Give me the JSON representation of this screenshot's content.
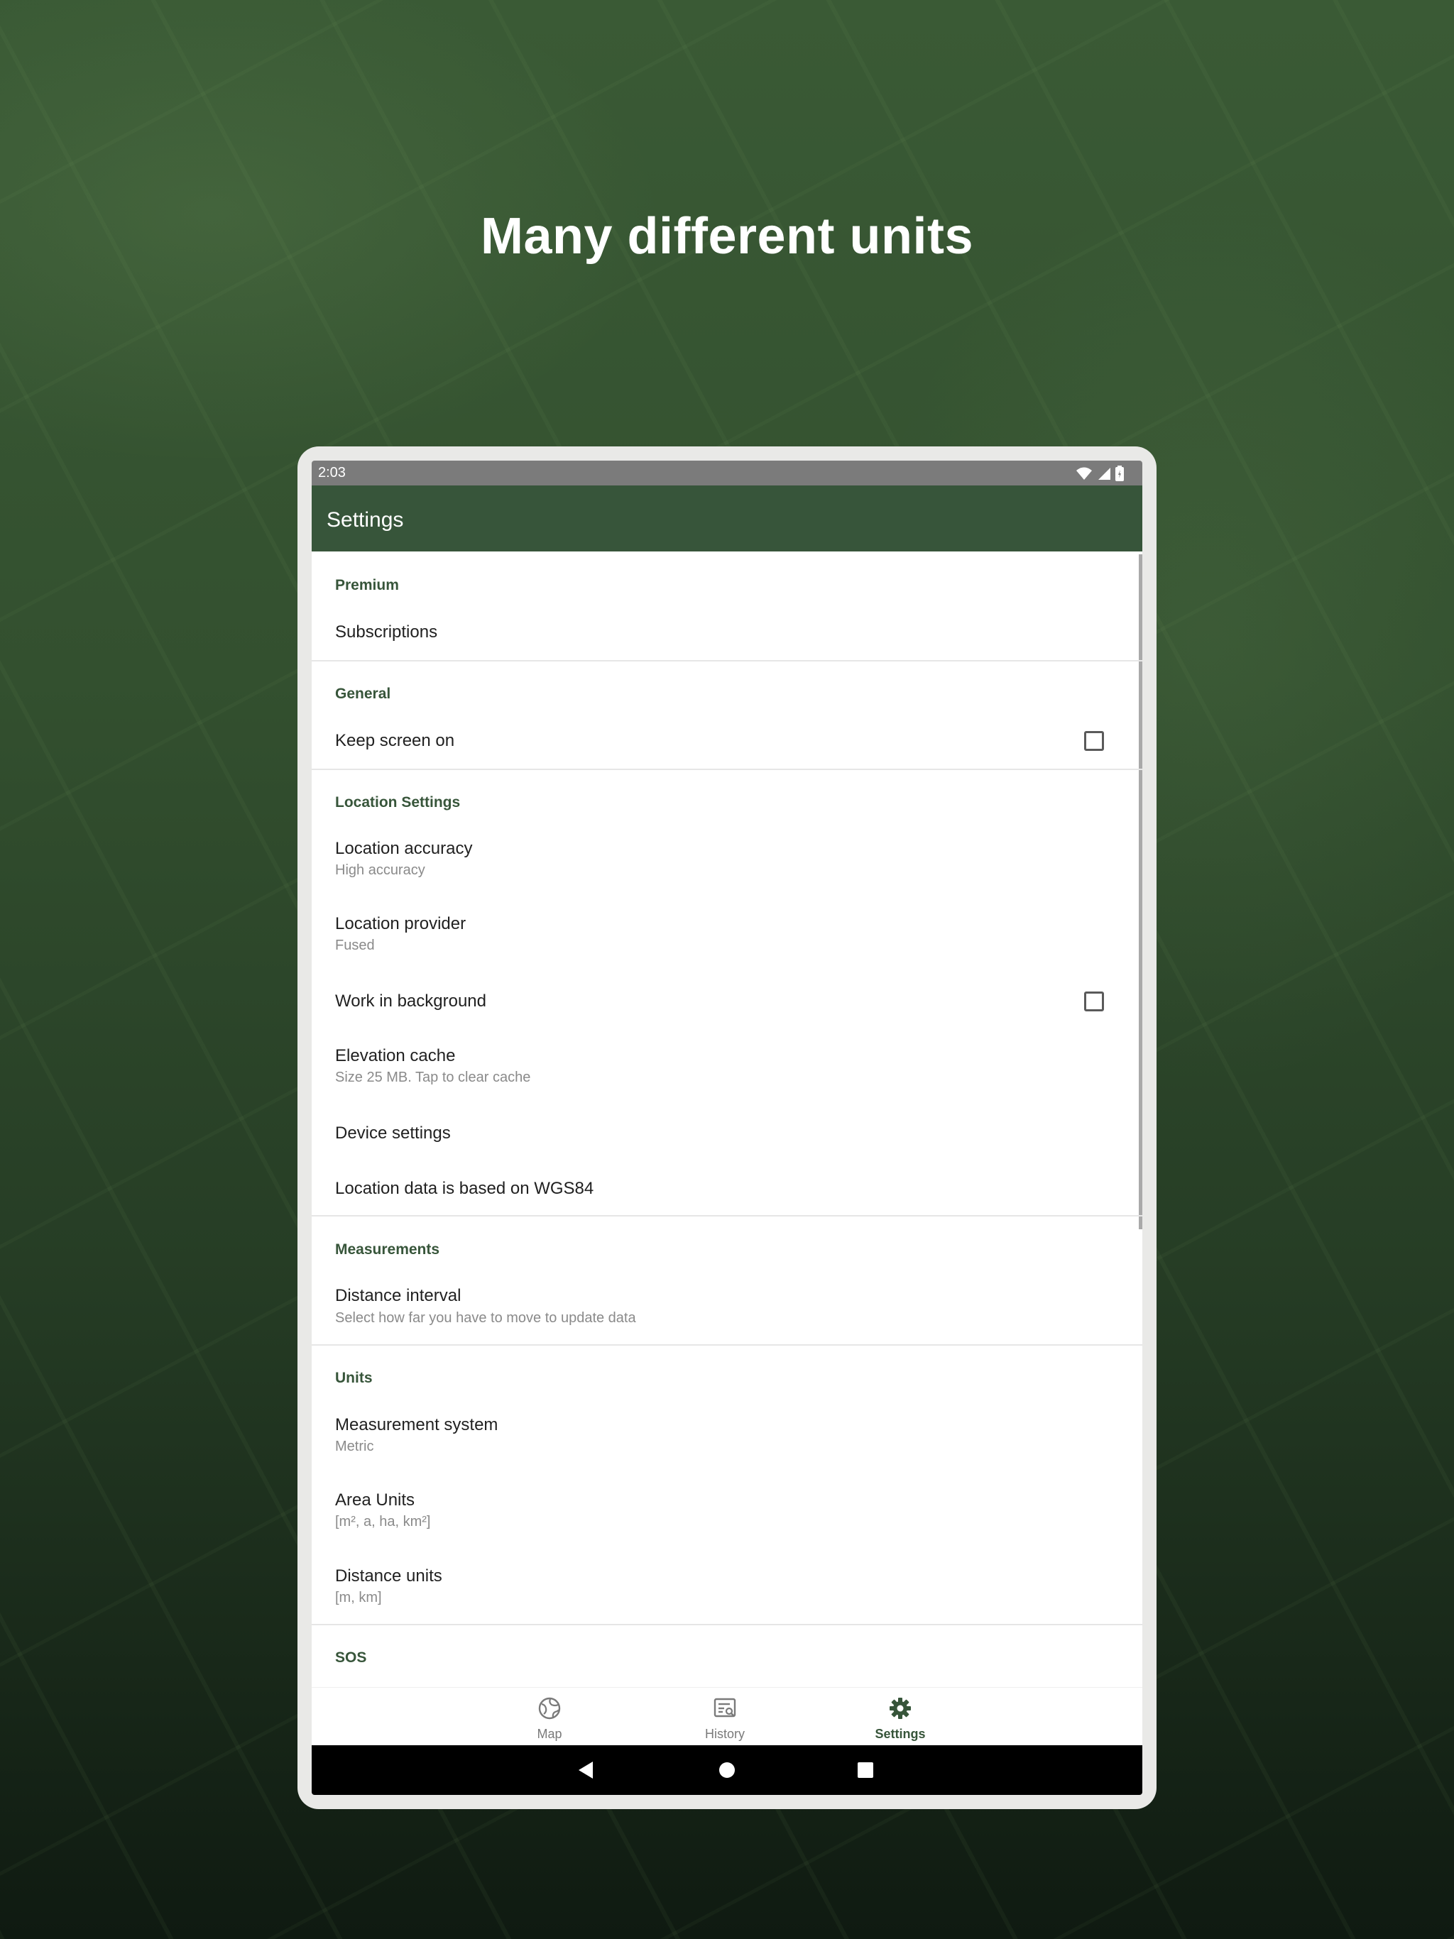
{
  "headline": "Many different units",
  "status": {
    "time": "2:03",
    "icons": [
      "wifi-icon",
      "signal-icon",
      "battery-icon"
    ]
  },
  "appbar": {
    "title": "Settings"
  },
  "sections": {
    "premium": {
      "title": "Premium",
      "subscriptions": "Subscriptions"
    },
    "general": {
      "title": "General",
      "keep_screen_on": "Keep screen on",
      "keep_screen_on_checked": false
    },
    "location": {
      "title": "Location Settings",
      "accuracy_title": "Location accuracy",
      "accuracy_value": "High accuracy",
      "provider_title": "Location provider",
      "provider_value": "Fused",
      "background_title": "Work in background",
      "background_checked": false,
      "elevation_title": "Elevation cache",
      "elevation_value": "Size 25 MB. Tap to clear cache",
      "device_settings": "Device settings",
      "wgs84": "Location data is based on WGS84"
    },
    "measurements": {
      "title": "Measurements",
      "distance_interval_title": "Distance interval",
      "distance_interval_value": "Select how far you have to move to update data"
    },
    "units": {
      "title": "Units",
      "system_title": "Measurement system",
      "system_value": "Metric",
      "area_title": "Area Units",
      "area_value": "[m², a, ha, km²]",
      "distance_title": "Distance units",
      "distance_value": "[m, km]"
    },
    "sos": {
      "title": "SOS"
    }
  },
  "bottom_nav": {
    "map": "Map",
    "history": "History",
    "settings": "Settings",
    "active": "settings"
  },
  "colors": {
    "accent": "#37553a",
    "status_bar": "#7b7b7b",
    "system_bar": "#000000"
  }
}
